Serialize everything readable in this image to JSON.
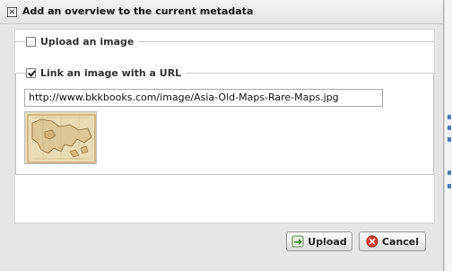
{
  "dialog": {
    "title": "Add an overview to the current metadata",
    "close_icon": "close-icon"
  },
  "upload_section": {
    "label": "Upload an image",
    "checked": false
  },
  "url_section": {
    "label": "Link an image with a URL",
    "checked": true,
    "url_value": "http://www.bkkbooks.com/image/Asia-Old-Maps-Rare-Maps.jpg",
    "preview_icon": "map-thumbnail"
  },
  "buttons": {
    "upload_label": "Upload",
    "upload_icon": "upload-arrow-icon",
    "cancel_label": "Cancel",
    "cancel_icon": "cancel-icon"
  },
  "colors": {
    "upload_icon": "#3a8a2c",
    "cancel_icon": "#d03a2f"
  }
}
